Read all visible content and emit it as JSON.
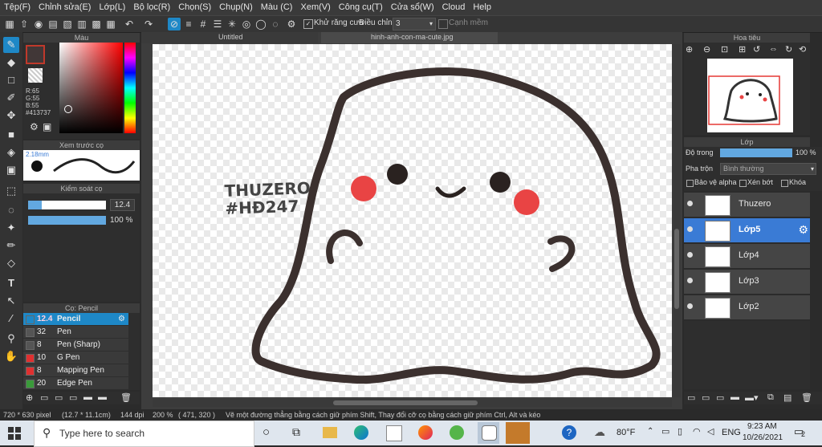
{
  "menu": [
    "Tệp(F)",
    "Chỉnh sửa(E)",
    "Lớp(L)",
    "Bộ lọc(R)",
    "Chọn(S)",
    "Chụp(N)",
    "Màu (C)",
    "Xem(V)",
    "Công cụ(T)",
    "Cửa sổ(W)",
    "Cloud",
    "Help"
  ],
  "toolbar": {
    "antialias_label": "Khử răng cưa",
    "adjust_label": "Điều chỉnh",
    "adjust_value": "3",
    "smooth_label": "Cạnh mềm"
  },
  "tabs": {
    "untitled": "Untitled",
    "file": "hinh-anh-con-ma-cute.jpg"
  },
  "color_panel": {
    "title": "Màu",
    "r": "R:65",
    "g": "G:55",
    "b": "B:55",
    "hex": "#413737",
    "fg": "#413737",
    "accent_border": "#c0392b"
  },
  "preview_panel": {
    "title": "Xem trước cọ",
    "size": "2.18mm"
  },
  "brush_control": {
    "title": "Kiểm soát cọ",
    "size_value": "12.4",
    "opacity_value": "100 %",
    "size_fraction": 0.18,
    "opacity_fraction": 1.0
  },
  "brush_panel": {
    "title": "Cọ: Pencil",
    "brushes": [
      {
        "size": "12.4",
        "name": "Pencil",
        "color": "#1e88c7",
        "selected": true
      },
      {
        "size": "32",
        "name": "Pen",
        "color": "#555555"
      },
      {
        "size": "8",
        "name": "Pen (Sharp)",
        "color": "#555555"
      },
      {
        "size": "10",
        "name": "G Pen",
        "color": "#e03030"
      },
      {
        "size": "8",
        "name": "Mapping Pen",
        "color": "#e03030"
      },
      {
        "size": "20",
        "name": "Edge Pen",
        "color": "#3a9a3a"
      }
    ]
  },
  "navigator": {
    "title": "Hoa tiêu"
  },
  "layer_panel": {
    "title": "Lớp",
    "opacity_label": "Độ trong",
    "opacity_value": "100 %",
    "opacity_fraction": 1.0,
    "blend_label": "Pha trộn",
    "blend_value": "Bình thường",
    "protect_alpha": "Bảo vệ alpha",
    "clipping": "Xén bớt",
    "lock": "Khóa",
    "layers": [
      {
        "name": "Thuzero",
        "selected": false
      },
      {
        "name": "Lớp5",
        "selected": true
      },
      {
        "name": "Lớp4",
        "selected": false
      },
      {
        "name": "Lớp3",
        "selected": false
      },
      {
        "name": "Lớp2",
        "selected": false
      }
    ]
  },
  "canvas_text": {
    "line1": "THUZERO",
    "line2": "#HĐ247"
  },
  "status": {
    "size": "720 * 630 pixel",
    "size_cm": "(12.7 * 11.1cm)",
    "dpi": "144 dpi",
    "zoom": "200 %",
    "coords": "( 471, 320 )",
    "hint": "Vẽ một đường thẳng bằng cách giữ phím Shift, Thay đổi cỡ cọ bằng cách giữ phím Ctrl, Alt và kéo"
  },
  "taskbar": {
    "search_placeholder": "Type here to search",
    "temp": "80°F",
    "lang": "ENG",
    "time": "9:23 AM",
    "date": "10/26/2021",
    "notif": "2"
  }
}
